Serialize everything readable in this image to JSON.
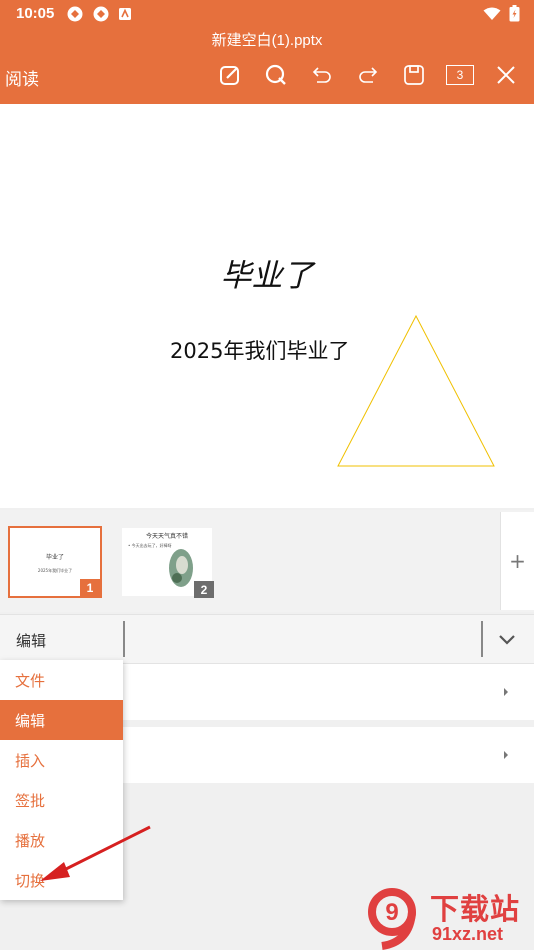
{
  "status_bar": {
    "time": "10:05"
  },
  "header": {
    "file_title": "新建空白(1).pptx",
    "read_label": "阅读",
    "page_count": "3",
    "icons": [
      "edit-icon",
      "search-icon",
      "undo-icon",
      "redo-icon",
      "save-icon",
      "page-count-icon",
      "close-icon"
    ]
  },
  "slide": {
    "title": "毕业了",
    "subtitle": "2025年我们毕业了"
  },
  "thumbnails": [
    {
      "number": "1",
      "title": "毕业了",
      "subtitle": "2025年我们毕业了"
    },
    {
      "number": "2",
      "title": "今天天气真不错",
      "subtitle": "• 今天出去玩了，好棒呀"
    }
  ],
  "add_slide_label": "+",
  "edit_bar": {
    "label": "编辑"
  },
  "menu": {
    "items": [
      {
        "label": "文件"
      },
      {
        "label": "编辑"
      },
      {
        "label": "插入"
      },
      {
        "label": "签批"
      },
      {
        "label": "播放"
      },
      {
        "label": "切换"
      }
    ],
    "selected": "编辑"
  },
  "watermark": {
    "text": "下载站",
    "url": "91xz.net",
    "logo": "9"
  },
  "colors": {
    "accent": "#e6703d",
    "annotation_arrow": "#d62020",
    "triangle": "#f0c000"
  }
}
